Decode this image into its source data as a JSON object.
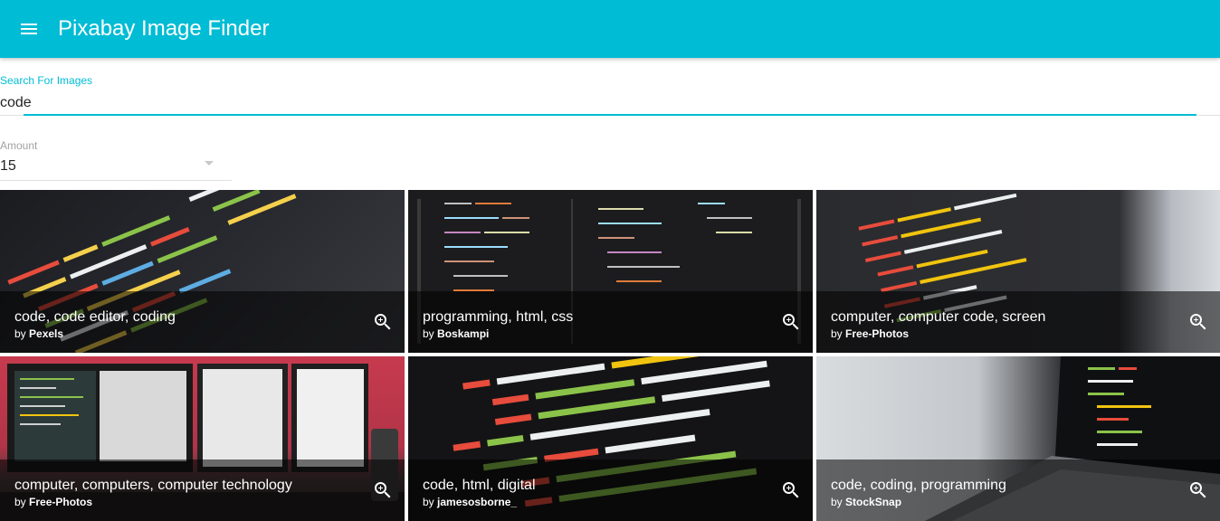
{
  "app": {
    "title": "Pixabay Image Finder",
    "menu_icon": "menu-icon"
  },
  "search": {
    "label": "Search For Images",
    "value": "code"
  },
  "amount": {
    "label": "Amount",
    "value": "15"
  },
  "colors": {
    "primary": "#00bcd4",
    "tile_overlay": "rgba(0,0,0,0.55)"
  },
  "results": [
    {
      "title": "code, code editor, coding",
      "by": "by",
      "author": "Pexels",
      "action_icon": "zoom-in-icon"
    },
    {
      "title": "programming, html, css",
      "by": "by",
      "author": "Boskampi",
      "action_icon": "zoom-in-icon"
    },
    {
      "title": "computer, computer code, screen",
      "by": "by",
      "author": "Free-Photos",
      "action_icon": "zoom-in-icon"
    },
    {
      "title": "computer, computers, computer technology",
      "by": "by",
      "author": "Free-Photos",
      "action_icon": "zoom-in-icon"
    },
    {
      "title": "code, html, digital",
      "by": "by",
      "author": "jamesosborne_",
      "action_icon": "zoom-in-icon"
    },
    {
      "title": "code, coding, programming",
      "by": "by",
      "author": "StockSnap",
      "action_icon": "zoom-in-icon"
    }
  ]
}
